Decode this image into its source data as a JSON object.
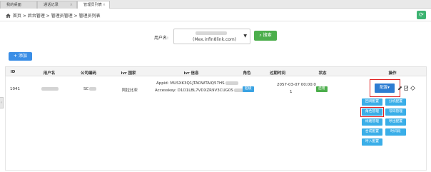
{
  "tabs": [
    {
      "label": "我的桌面",
      "active": false
    },
    {
      "label": "通话记录",
      "active": false
    },
    {
      "label": "管理员列表",
      "active": true
    }
  ],
  "breadcrumb": "首页 > 后台管理 > 管理员管理 > 管理员列表",
  "search": {
    "label": "用户名:",
    "select_value": "(Mex.infin8link.com)",
    "button_label": "搜索"
  },
  "toolbar": {
    "add_label": "+ 添加"
  },
  "table": {
    "headers": [
      "ID",
      "用户名",
      "公司编码",
      "ivr 国家",
      "ivr 信息",
      "角色",
      "过期时间",
      "状态",
      "操作"
    ],
    "row": {
      "id": "1041",
      "company_code": "SC",
      "ivr_country": "阿拉比亚",
      "ivr_appid": "Appid:  MUSXK3Q1JTAOWTAIQ57HS",
      "ivr_key": "Accesskey:  D1O1LBL7VDXZR9V3CUG0S",
      "role": "超级",
      "expire_line1": "2057-03-07 00:00:0",
      "expire_line2": "1",
      "status": "启用",
      "config_label": "配置▾"
    },
    "ops": [
      "回调配置",
      "分机配置",
      "角色管理",
      "号码管理",
      "线路管理",
      "呼出配置",
      "合成配置",
      "时间段",
      "呼入配置"
    ]
  },
  "colors": {
    "primary": "#2d7dd2",
    "success": "#4cae4c",
    "info": "#3aaee8",
    "highlight": "#e02020"
  }
}
